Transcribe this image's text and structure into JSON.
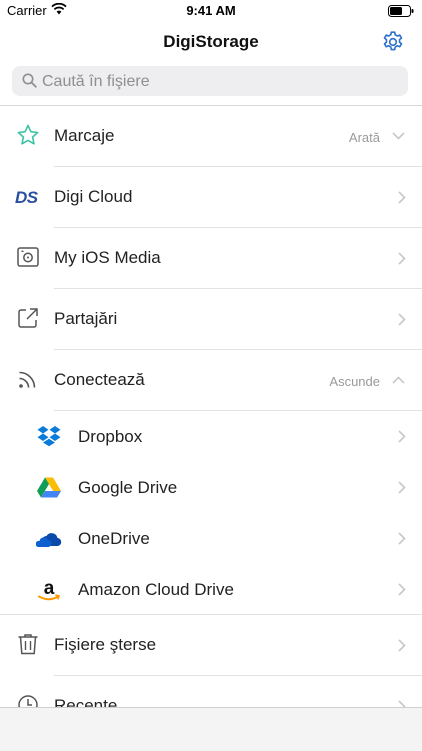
{
  "status_bar": {
    "carrier": "Carrier",
    "time": "9:41 AM"
  },
  "nav": {
    "title": "DigiStorage"
  },
  "search": {
    "placeholder": "Caută în fişiere"
  },
  "sections": {
    "marcaje": {
      "label": "Marcaje",
      "meta": "Arată"
    },
    "digi_cloud": {
      "label": "Digi Cloud",
      "logo_text": "DS"
    },
    "ios_media": {
      "label": "My iOS Media"
    },
    "partajari": {
      "label": "Partajări"
    },
    "conecteaza": {
      "label": "Conectează",
      "meta": "Ascunde"
    },
    "deleted": {
      "label": "Fişiere şterse"
    },
    "recent": {
      "label": "Recente"
    }
  },
  "connect_items": [
    {
      "label": "Dropbox",
      "icon": "dropbox-icon"
    },
    {
      "label": "Google Drive",
      "icon": "google-drive-icon"
    },
    {
      "label": "OneDrive",
      "icon": "onedrive-icon"
    },
    {
      "label": "Amazon Cloud Drive",
      "icon": "amazon-icon"
    }
  ],
  "colors": {
    "accent": "#2a6fc9",
    "star": "#3cc3a5",
    "digi_blue": "#2b4fa0",
    "amazon_orange": "#ff9900"
  }
}
